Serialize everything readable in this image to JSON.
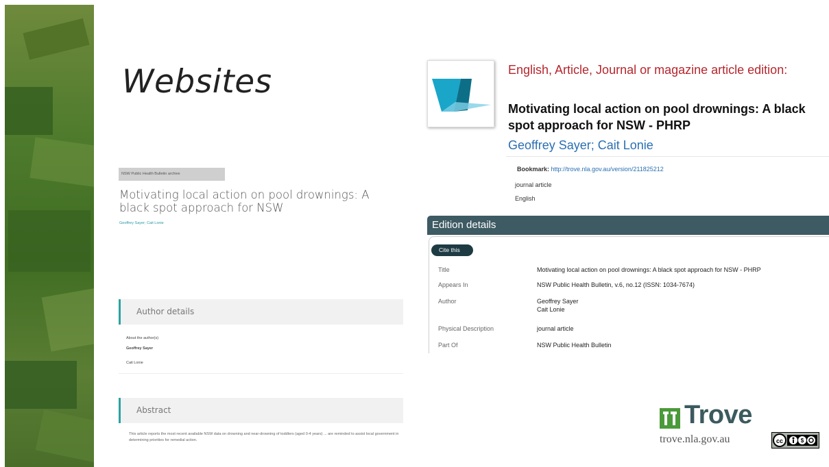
{
  "slide": {
    "title": "Websites"
  },
  "nsw_page": {
    "archive_badge": "NSW Public Health Bulletin archive",
    "article_title": "Motivating local action on pool drownings: A black spot approach for NSW",
    "authors": "Geoffrey Sayer; Cait Lonie",
    "author_details_heading": "Author details",
    "about_authors_label": "About the author(s)",
    "author_1": "Geoffrey Sayer",
    "author_2": "Cait Lonie",
    "abstract_heading": "Abstract",
    "abstract_text": "This article reports the most recent available NSW data on drowning and near-drowning of toddlers (aged 0-4 years) ... are reminded to assist local government in determining priorities for remedial action."
  },
  "trove_record": {
    "format_line": "English, Article, Journal or magazine article edition:",
    "title": "Motivating local action on pool drownings: A black spot approach for NSW - PHRP",
    "authors": "Geoffrey Sayer; Cait Lonie",
    "bookmark_label": "Bookmark:",
    "bookmark_url": "http://trove.nla.gov.au/version/211825212",
    "type": "journal article",
    "language": "English",
    "edition_heading": "Edition details",
    "cite_button": "Cite this",
    "details": {
      "title_label": "Title",
      "title_value": "Motivating local action on pool drownings: A black spot approach for NSW - PHRP",
      "appears_label": "Appears In",
      "appears_value": "NSW Public Health Bulletin, v.6, no.12 (ISSN: 1034-7674)",
      "author_label": "Author",
      "author_value_1": "Geoffrey Sayer",
      "author_value_2": "Cait Lonie",
      "physical_label": "Physical Description",
      "physical_value": "journal article",
      "partof_label": "Part Of",
      "partof_value": "NSW Public Health Bulletin"
    }
  },
  "branding": {
    "trove_name": "Trove",
    "trove_url": "trove.nla.gov.au",
    "license_badge": "cc-by-nc-sa-icon"
  },
  "colors": {
    "format_red": "#b5262d",
    "link_blue": "#2a6fb2",
    "edition_bar": "#3e5a63",
    "accent_teal": "#2aa3a3"
  }
}
